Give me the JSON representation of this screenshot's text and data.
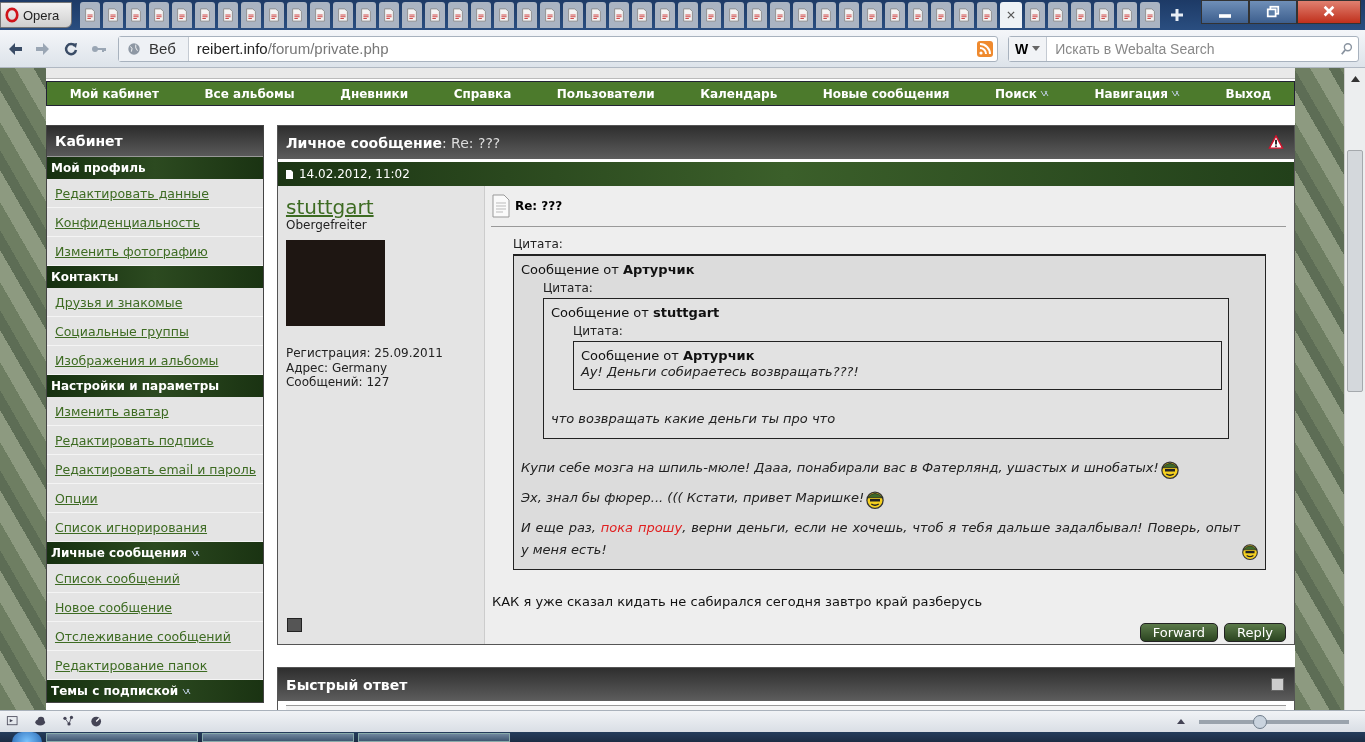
{
  "browser": {
    "app_menu": "Opera",
    "tabs": [
      {
        "selected": false
      },
      {
        "selected": false
      },
      {
        "selected": false
      },
      {
        "selected": false
      },
      {
        "selected": false
      },
      {
        "selected": false
      },
      {
        "selected": false
      },
      {
        "selected": false
      },
      {
        "selected": false
      },
      {
        "selected": false
      },
      {
        "selected": false
      },
      {
        "selected": false
      },
      {
        "selected": false
      },
      {
        "selected": false
      },
      {
        "selected": false
      },
      {
        "selected": false
      },
      {
        "selected": false
      },
      {
        "selected": false
      },
      {
        "selected": false
      },
      {
        "selected": false
      },
      {
        "selected": false
      },
      {
        "selected": false
      },
      {
        "selected": false
      },
      {
        "selected": false
      },
      {
        "selected": false
      },
      {
        "selected": false
      },
      {
        "selected": false
      },
      {
        "selected": false
      },
      {
        "selected": false
      },
      {
        "selected": false
      },
      {
        "selected": false
      },
      {
        "selected": false
      },
      {
        "selected": false
      },
      {
        "selected": false
      },
      {
        "selected": false
      },
      {
        "selected": false
      },
      {
        "selected": false
      },
      {
        "selected": false
      },
      {
        "selected": false
      },
      {
        "selected": false
      },
      {
        "selected": true
      },
      {
        "selected": false
      },
      {
        "selected": false
      },
      {
        "selected": false
      },
      {
        "selected": false
      },
      {
        "selected": false
      },
      {
        "selected": false
      }
    ],
    "address": {
      "zone_label": "Веб",
      "host": "reibert.info",
      "path": "/forum/private.php"
    },
    "search": {
      "engine": "W",
      "placeholder": "Искать в Webalta Search"
    }
  },
  "nav": [
    {
      "label": "Мой кабинет",
      "dropdown": false
    },
    {
      "label": "Все альбомы",
      "dropdown": false
    },
    {
      "label": "Дневники",
      "dropdown": false
    },
    {
      "label": "Справка",
      "dropdown": false
    },
    {
      "label": "Пользователи",
      "dropdown": false
    },
    {
      "label": "Календарь",
      "dropdown": false
    },
    {
      "label": "Новые сообщения",
      "dropdown": false
    },
    {
      "label": "Поиск",
      "dropdown": true
    },
    {
      "label": "Навигация",
      "dropdown": true
    },
    {
      "label": "Выход",
      "dropdown": false
    }
  ],
  "sidebar": {
    "title": "Кабинет",
    "sections": [
      {
        "title": "Мой профиль",
        "dropdown": false,
        "items": [
          "Редактировать данные",
          "Конфиденциальность",
          "Изменить фотографию"
        ]
      },
      {
        "title": "Контакты",
        "dropdown": false,
        "items": [
          "Друзья и знакомые",
          "Социальные группы",
          "Изображения и альбомы"
        ]
      },
      {
        "title": "Настройки и параметры",
        "dropdown": false,
        "items": [
          "Изменить аватар",
          "Редактировать подпись",
          "Редактировать email и пароль",
          "Опции",
          "Список игнорирования"
        ]
      },
      {
        "title": "Личные сообщения",
        "dropdown": true,
        "items": [
          "Список сообщений",
          "Новое сообщение",
          "Отслеживание сообщений",
          "Редактирование папок"
        ]
      },
      {
        "title": "Темы с подпиской",
        "dropdown": true
      }
    ]
  },
  "message": {
    "title": "**Личное сообщение**: Re: ???",
    "date": "14.02.2012, 11:02",
    "author": {
      "name": "stuttgart",
      "rank": "Obergefreiter",
      "details": [
        "Регистрация: 25.09.2011",
        "Адрес: Germany",
        "Сообщений: 127"
      ]
    },
    "subject": "Re: ???",
    "quote": {
      "label": "Цитата:",
      "header": "Сообщение от **Артурчик**",
      "quote": {
        "label": "Цитата:",
        "header": "Сообщение от **stuttgart**",
        "quote": {
          "label": "Цитата:",
          "header": "Сообщение от **Артурчик**",
          "paragraphs": [
            {
              "segments": [
                {
                  "kind": "text",
                  "text": "Ау! Деньги собираетесь возвращать???!"
                }
              ]
            }
          ]
        },
        "paragraphs": [
          {
            "segments": [
              {
                "kind": "text",
                "text": "что возвращать какие деньги ты про что"
              }
            ]
          }
        ]
      },
      "paragraphs": [
        {
          "segments": [
            {
              "kind": "text",
              "text": "Купи себе мозга на шпиль-мюле! Дааа, понабирали вас в Фатерлянд, ушастых и шнобатых!"
            },
            {
              "kind": "smiley"
            }
          ]
        },
        {
          "segments": [
            {
              "kind": "text",
              "text": "Эх, знал бы фюрер... ((( Кстати, привет Маришке!"
            },
            {
              "kind": "smiley"
            }
          ]
        },
        {
          "segments": [
            {
              "kind": "text",
              "text": "И еще раз, "
            },
            {
              "kind": "highlight",
              "text": "пока прошу"
            },
            {
              "kind": "text",
              "text": ", верни деньги, если не хочешь, чтоб я тебя дальше задалбывал! Поверь, опыт у меня есть!"
            },
            {
              "kind": "smiley"
            }
          ]
        }
      ]
    },
    "reply_text": "КАК я уже сказал кидать не сабирался сегодня завтро край разберусь",
    "buttons": [
      "Forward",
      "Reply"
    ]
  },
  "quick_reply": {
    "title": "Быстрый ответ"
  },
  "status_bar": {
    "zoom": {
      "level": 0.4
    }
  }
}
